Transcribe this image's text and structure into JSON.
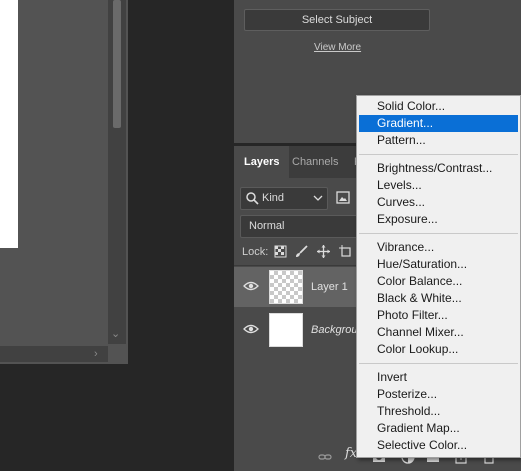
{
  "properties": {
    "select_subject_label": "Select Subject",
    "view_more_label": "View More"
  },
  "layers_panel": {
    "tabs": [
      "Layers",
      "Channels",
      "P"
    ],
    "filter_kind": "Kind",
    "blend_mode": "Normal",
    "lock_label": "Lock:",
    "layers": [
      {
        "name": "Layer 1",
        "thumbnail": "transparent",
        "visible": true,
        "selected": true
      },
      {
        "name": "Background",
        "thumbnail": "white",
        "visible": true,
        "selected": false
      }
    ],
    "footer": {
      "fx_label": "fx"
    }
  },
  "adjustment_menu": {
    "selected": "Gradient...",
    "groups": [
      [
        "Solid Color...",
        "Gradient...",
        "Pattern..."
      ],
      [
        "Brightness/Contrast...",
        "Levels...",
        "Curves...",
        "Exposure..."
      ],
      [
        "Vibrance...",
        "Hue/Saturation...",
        "Color Balance...",
        "Black & White...",
        "Photo Filter...",
        "Channel Mixer...",
        "Color Lookup..."
      ],
      [
        "Invert",
        "Posterize...",
        "Threshold...",
        "Gradient Map...",
        "Selective Color..."
      ]
    ]
  },
  "colors": {
    "accent": "#0a6fd6",
    "panel": "#4a4a4a",
    "menu_bg": "#f0f0f0"
  },
  "icons": {
    "kind_search": "search-icon",
    "image_filter": "image-icon",
    "eye": "eye-icon",
    "link_layers": "link-icon",
    "fx": "fx-icon",
    "add_mask": "mask-icon",
    "adjustment": "adjustment-icon",
    "new_group": "folder-icon",
    "new_layer": "new-layer-icon",
    "delete": "trash-icon"
  }
}
